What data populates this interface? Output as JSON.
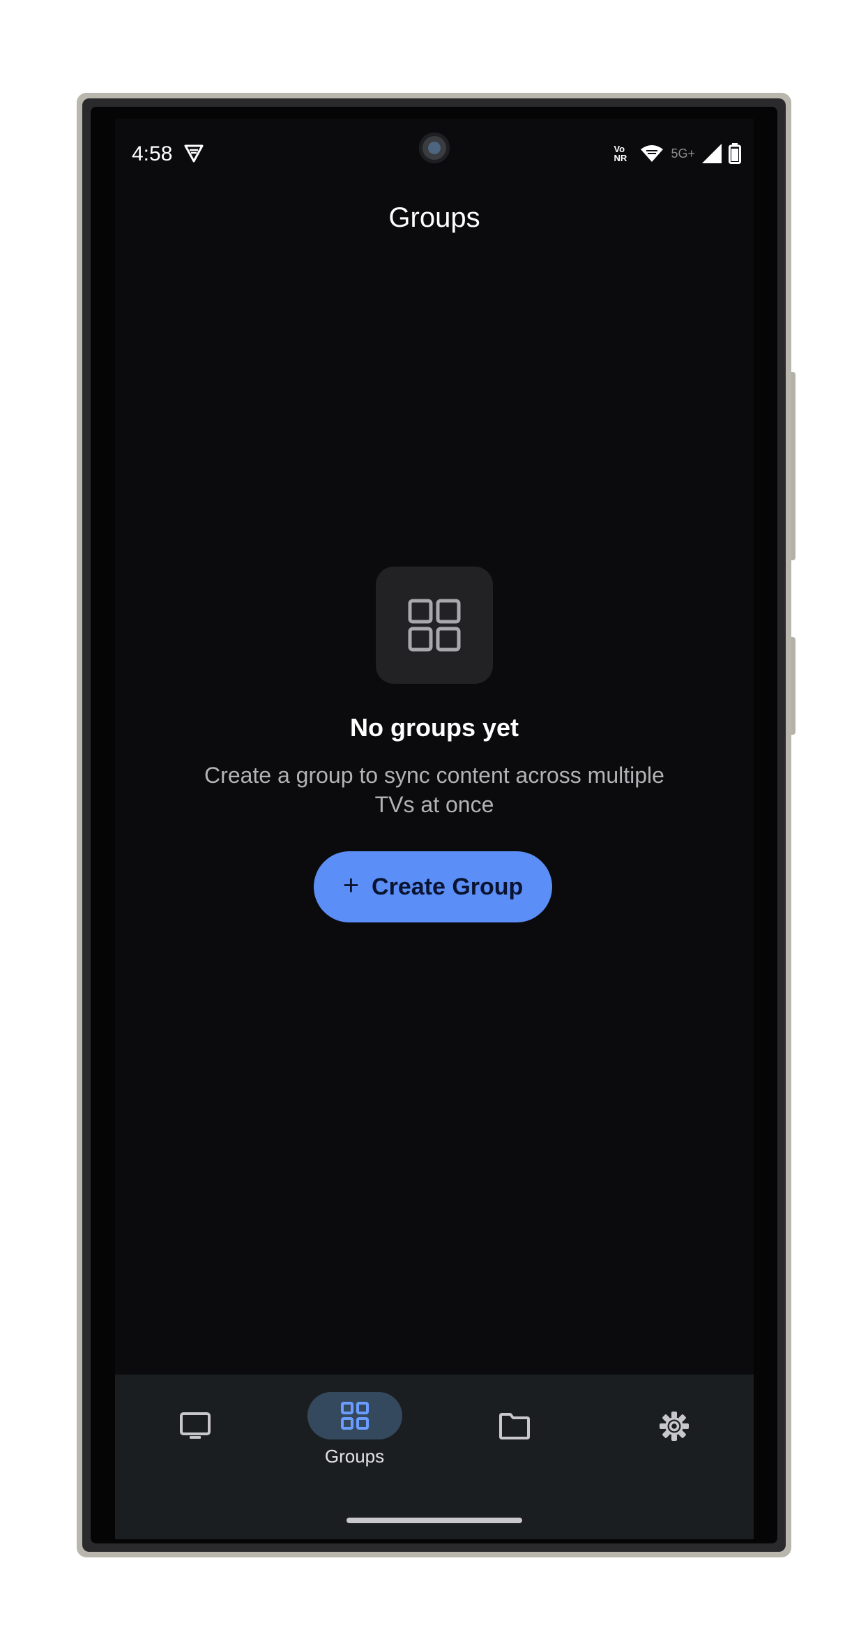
{
  "status_bar": {
    "time": "4:58",
    "vpn_icon": "vpn-shield-icon",
    "network_label": "Vo NR",
    "network_type": "5G+",
    "icons": [
      "wifi-icon",
      "signal-icon",
      "battery-icon"
    ]
  },
  "header": {
    "title": "Groups"
  },
  "empty_state": {
    "icon": "grid-icon",
    "title": "No groups yet",
    "description": "Create a group to sync content across multiple TVs at once",
    "button_label": "Create Group",
    "button_icon": "plus-icon"
  },
  "bottom_nav": {
    "items": [
      {
        "id": "tvs",
        "icon": "tv-icon",
        "label": "",
        "active": false
      },
      {
        "id": "groups",
        "icon": "grid-icon",
        "label": "Groups",
        "active": true
      },
      {
        "id": "files",
        "icon": "folder-icon",
        "label": "",
        "active": false
      },
      {
        "id": "settings",
        "icon": "gear-icon",
        "label": "",
        "active": false
      }
    ]
  },
  "colors": {
    "background": "#0b0b0d",
    "accent": "#5b8ef7",
    "nav_background": "#1b1e21",
    "nav_active_pill": "#35495e",
    "active_icon": "#6b9cff"
  }
}
